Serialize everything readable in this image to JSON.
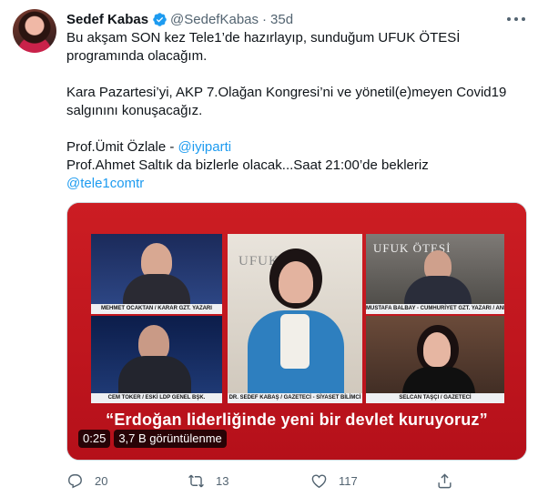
{
  "author": {
    "display_name": "Sedef Kabas",
    "handle": "@SedefKabas",
    "separator": "·",
    "time": "35d"
  },
  "tweet": {
    "line1": "Bu akşam SON kez Tele1’de hazırlayıp, sunduğum UFUK ÖTESİ programında olacağım.",
    "line2": "Kara Pazartesi’yi, AKP 7.Olağan Kongresi’ni ve yönetil(e)meyen Covid19 salgınını konuşacağız.",
    "line3_prefix": "Prof.Ümit Özlale - ",
    "mention_iyiparti": "@iyiparti",
    "line4": "Prof.Ahmet Saltık da bizlerle olacak...Saat 21:00’de bekleriz",
    "mention_tele1": "@tele1comtr"
  },
  "video": {
    "captions": {
      "p1": "MEHMET OCAKTAN / KARAR GZT. YAZARI",
      "p2": "CEM TOKER / ESKİ LDP GENEL BŞK.",
      "p3": "DR. SEDEF KABAŞ / GAZETECİ - SİYASET BİLİMCİ",
      "p4": "MUSTAFA BALBAY - CUMHURİYET GZT. YAZARI / ANKARA STD.",
      "p5": "SELCAN TAŞÇI / GAZETECİ"
    },
    "logo_text_center": "UFUK",
    "logo_text_right": "UFUK ÖTESİ",
    "subtitle": "“Erdoğan liderliğinde yeni bir devlet kuruyoruz”",
    "duration": "0:25",
    "views": "3,7 B görüntülenme"
  },
  "actions": {
    "replies": "20",
    "retweets": "13",
    "likes": "117"
  },
  "icons": {
    "verified": "verified-badge-icon",
    "more": "more-dots-icon",
    "reply": "reply-icon",
    "retweet": "retweet-icon",
    "like": "heart-icon",
    "share": "share-icon"
  },
  "colors": {
    "link": "#1d9bf0",
    "secondary_text": "#536471",
    "video_bg": "#c1121c"
  }
}
